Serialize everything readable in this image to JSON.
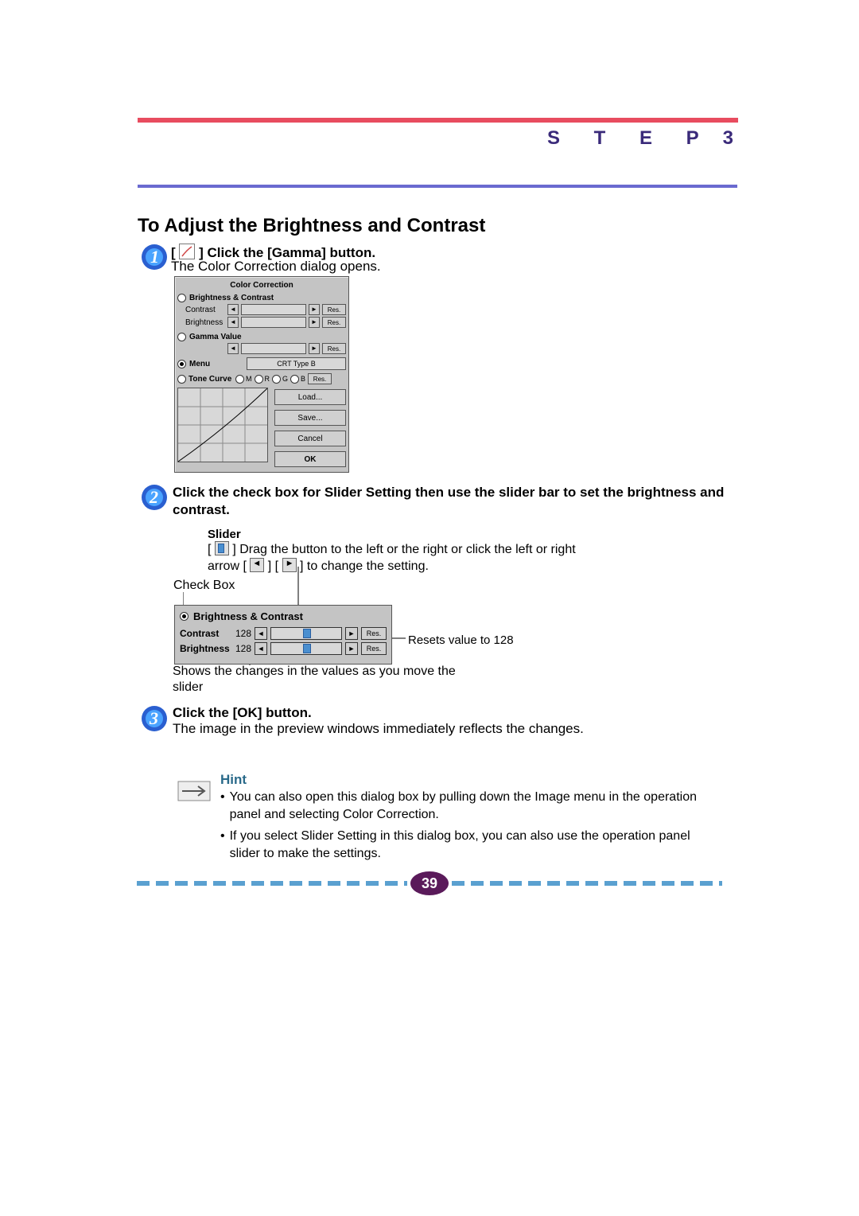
{
  "header": {
    "step_word": "S T E P",
    "step_num": "3"
  },
  "title": "To Adjust the Brightness and Contrast",
  "step1": {
    "head_prefix": "[ ",
    "head_suffix": " ] Click the [Gamma] button.",
    "sub": "The Color Correction dialog opens."
  },
  "dialog": {
    "title": "Color Correction",
    "bc_label": "Brightness & Contrast",
    "contrast_label": "Contrast",
    "brightness_label": "Brightness",
    "gamma_label": "Gamma Value",
    "menu_label": "Menu",
    "menu_value": "CRT Type B",
    "tone_label": "Tone Curve",
    "channels": {
      "m": "M",
      "r": "R",
      "g": "G",
      "b": "B"
    },
    "res": "Res.",
    "buttons": {
      "load": "Load...",
      "save": "Save...",
      "cancel": "Cancel",
      "ok": "OK"
    }
  },
  "step2": {
    "head": "Click the check box for Slider Setting then use the slider bar to set the brightness and contrast."
  },
  "slider_box": {
    "title": "Slider",
    "desc_prefix": "[ ",
    "desc_mid": " ] Drag the button to the left or the right or click the left or right arrow [ ",
    "desc_mid2": " ] [ ",
    "desc_suffix": " ] to change the setting."
  },
  "checkbox_label": "Check Box",
  "detail": {
    "head": "Brightness & Contrast",
    "contrast_label": "Contrast",
    "contrast_val": "128",
    "brightness_label": "Brightness",
    "brightness_val": "128",
    "res": "Res."
  },
  "reset_note": "Resets value to 128",
  "slider_note": "Shows the changes in the values as you move the slider",
  "step3": {
    "head": "Click the [OK] button.",
    "sub": "The image in the preview windows immediately reflects the changes."
  },
  "hint": {
    "title": "Hint",
    "items": [
      "You can also open this dialog box by pulling down the Image menu in the operation panel and selecting Color Correction.",
      "If you select Slider Setting in this dialog box, you can also use the operation panel slider to make the settings."
    ]
  },
  "page_number": "39"
}
